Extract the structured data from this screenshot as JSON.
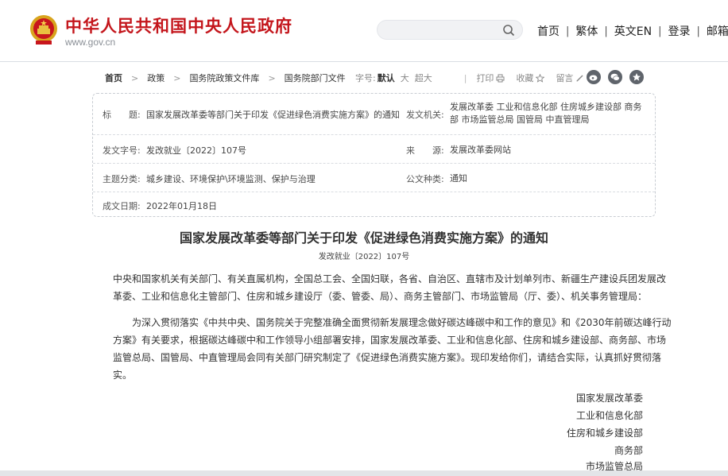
{
  "header": {
    "site_title": "中华人民共和国中央人民政府",
    "site_domain": "www.gov.cn",
    "search_placeholder": "",
    "nav": [
      "首页",
      "繁体",
      "英文EN",
      "登录",
      "邮箱"
    ],
    "nav_separator": "|",
    "brand_color": "#c4161c"
  },
  "breadcrumb": {
    "items": [
      "首页",
      "政策",
      "国务院政策文件库",
      "国务院部门文件"
    ],
    "arrow": ">"
  },
  "tools": {
    "font_label": "字号:",
    "font_default": "默认",
    "font_large": "大",
    "font_xlarge": "超大",
    "divider": "|",
    "print": "打印",
    "favorite": "收藏",
    "comment": "留言",
    "share_icons": [
      "weibo-icon",
      "wechat-icon",
      "qzone-icon"
    ]
  },
  "info": {
    "title_label": "标　　题:",
    "title_value": "国家发展改革委等部门关于印发《促进绿色消费实施方案》的通知",
    "issuer_label": "发文机关:",
    "issuer_value": "发展改革委  工业和信息化部  住房城乡建设部  商务部  市场监管总局  国管局  中直管理局",
    "docno_label": "发文字号:",
    "docno_value": "发改就业〔2022〕107号",
    "source_label": "来　　源:",
    "source_value": "发展改革委网站",
    "topic_label": "主题分类:",
    "topic_value": "城乡建设、环境保护\\环境监测、保护与治理",
    "type_label": "公文种类:",
    "type_value": "通知",
    "date_label": "成文日期:",
    "date_value": "2022年01月18日"
  },
  "article": {
    "title": "国家发展改革委等部门关于印发《促进绿色消费实施方案》的通知",
    "doc_number": "发改就业〔2022〕107号",
    "para1": [
      "中央和国家机关有关部门、有关直属机构，全国总工会、全国妇联，各省、自治区、直辖市及计划单列市、新疆生产建设兵团发展改",
      "革委、工业和信息化主管部门、住房和城乡建设厅（委、管委、局）、商务主管部门、市场监管局（厅、委）、机关事务管理局："
    ],
    "para2": [
      "　　为深入贯彻落实《中共中央、国务院关于完整准确全面贯彻新发展理念做好碳达峰碳中和工作的意见》和《2030年前碳达峰行动",
      "方案》有关要求，根据碳达峰碳中和工作领导小组部署安排，国家发展改革委、工业和信息化部、住房和城乡建设部、商务部、市场",
      "监管总局、国管局、中直管理局会同有关部门研究制定了《促进绿色消费实施方案》。现印发给你们，请结合实际，认真抓好贯彻落",
      "实。"
    ],
    "signatories": [
      "国家发展改革委",
      "工业和信息化部",
      "住房和城乡建设部",
      "商务部",
      "市场监管总局"
    ]
  }
}
